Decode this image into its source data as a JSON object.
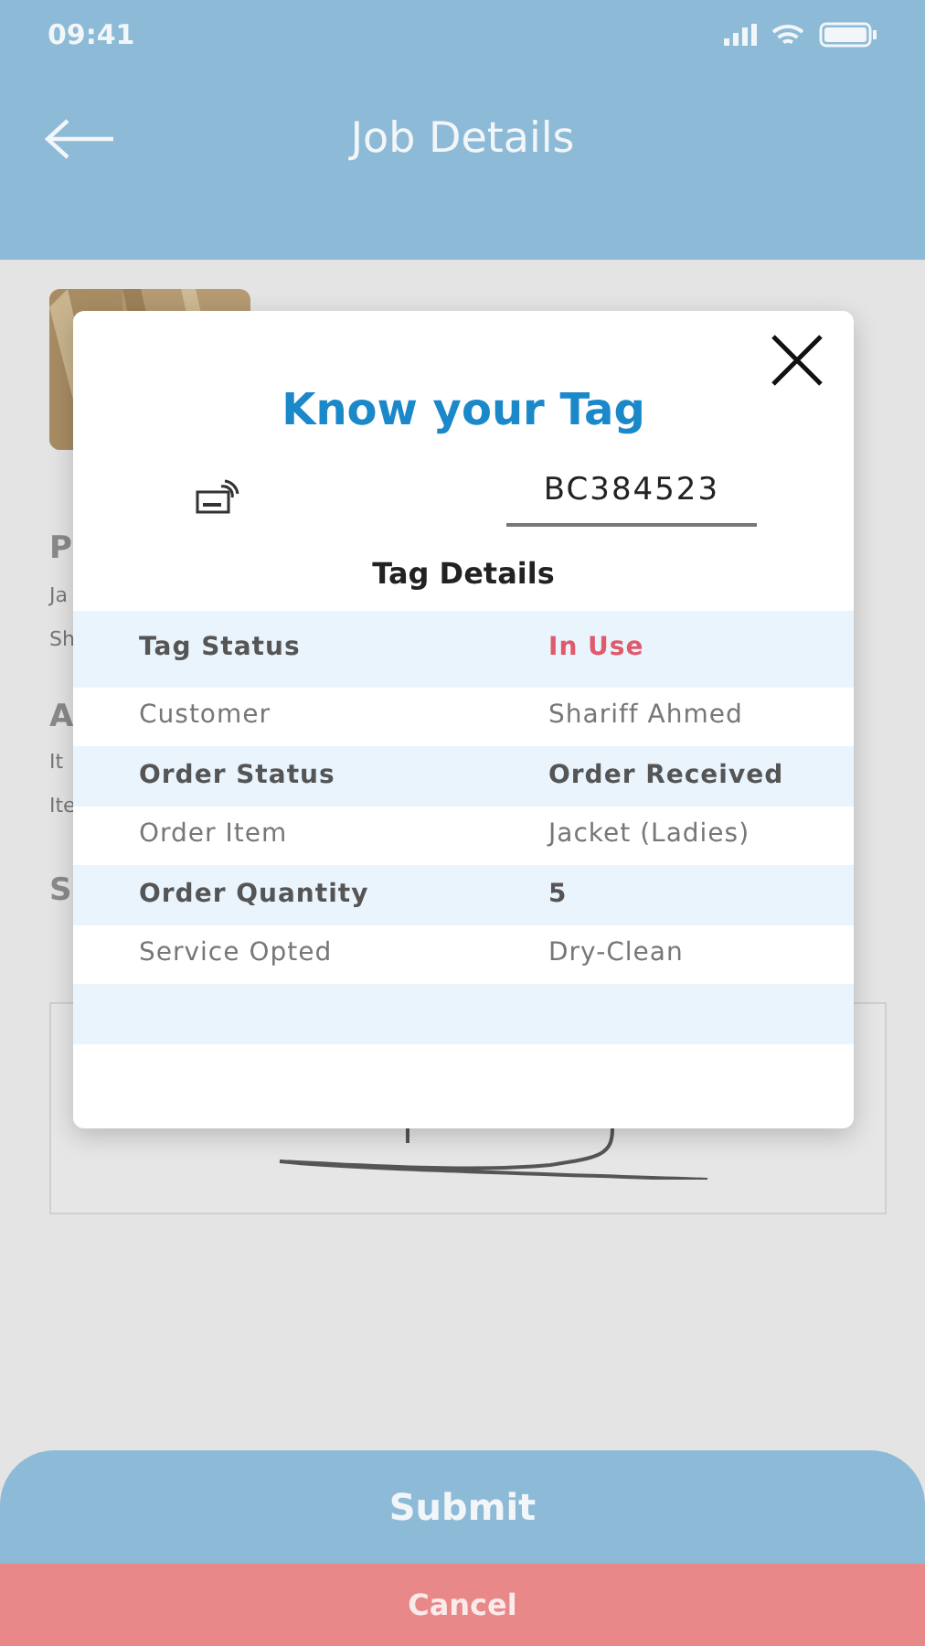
{
  "status_bar": {
    "time": "09:41"
  },
  "header": {
    "title": "Job Details"
  },
  "background": {
    "sections": [
      {
        "heading": "P",
        "lines": [
          "Ja",
          "Sh"
        ]
      },
      {
        "heading": "A",
        "lines": [
          "It",
          "Ite"
        ]
      },
      {
        "heading": "S"
      }
    ]
  },
  "dialog": {
    "title": "Know your Tag",
    "tag_field": {
      "value": "BC384523"
    },
    "section_title": "Tag Details",
    "rows": [
      {
        "label": "Tag Status",
        "value": "In Use",
        "kind": "alert"
      },
      {
        "label": "Customer",
        "value": "Shariff Ahmed",
        "kind": "plain"
      },
      {
        "label": "Order Status",
        "value": "Order Received",
        "kind": "plain"
      },
      {
        "label": "Order Item",
        "value": "Jacket (Ladies)",
        "kind": "plain"
      },
      {
        "label": "Order Quantity",
        "value": "5",
        "kind": "plain"
      },
      {
        "label": "Service Opted",
        "value": "Dry-Clean",
        "kind": "plain"
      }
    ]
  },
  "buttons": [
    {
      "label": "Submit",
      "kind": "primary"
    },
    {
      "label": "Cancel",
      "kind": "danger"
    }
  ]
}
